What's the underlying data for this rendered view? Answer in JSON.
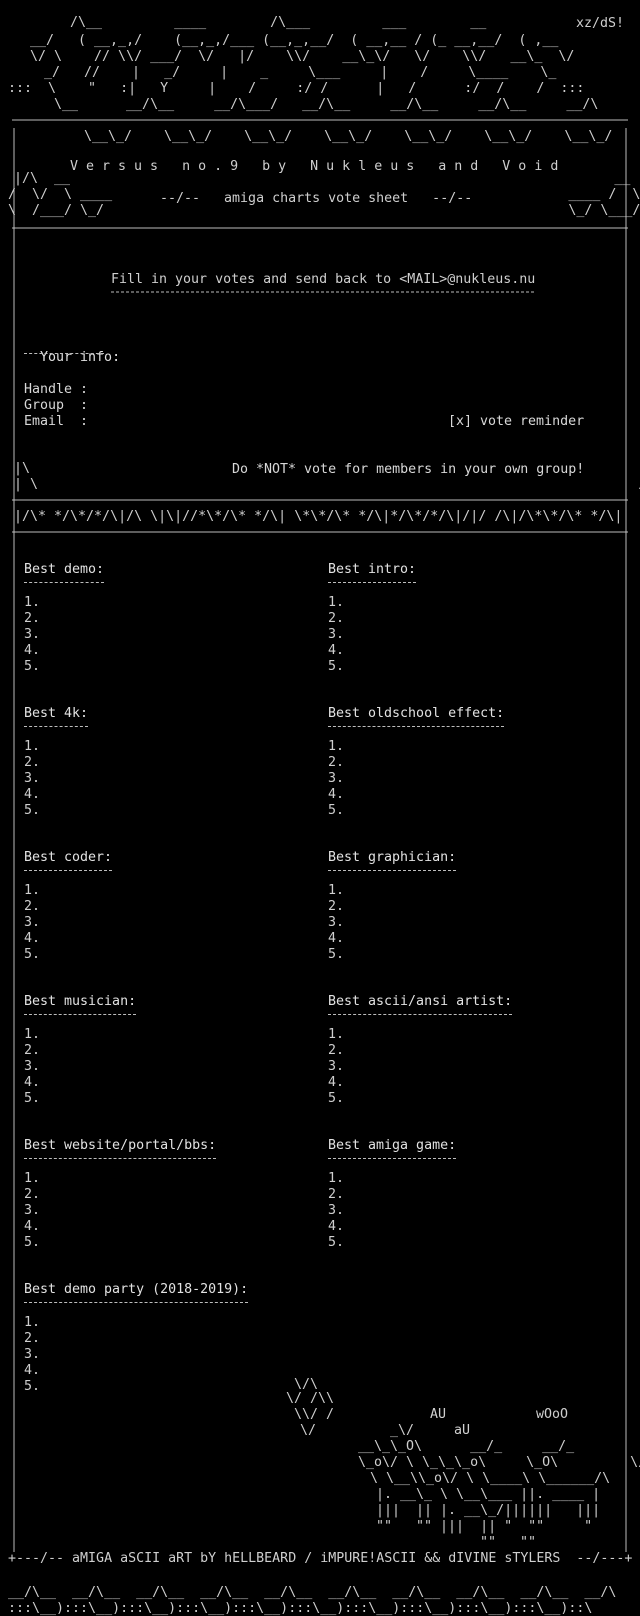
{
  "header": {
    "tag": "xz/dS!",
    "title": "V e r s u s   n o . 9   b y   N u k l e u s   a n d   V o i d",
    "subtitle": "--/--   amiga charts vote sheet   --/--"
  },
  "instruction": {
    "text": "Fill in your votes and send back to <MAIL>@nukleus.nu"
  },
  "info": {
    "heading": "Your info:",
    "handle_label": "Handle :",
    "group_label": "Group  :",
    "email_label": "Email  :",
    "reminder": "[x] vote reminder",
    "warning": "Do *NOT* vote for members in your own group!"
  },
  "divider": "|/\\* */\\*/*/\\|/\\ \\|\\|//*\\*/\\* */\\| \\*\\*/\\* */\\|*/\\*/*/\\|/|/ /\\|/\\*\\*/\\* */\\|",
  "categories": [
    {
      "title": "Best demo:",
      "slots": [
        "1.",
        "2.",
        "3.",
        "4.",
        "5."
      ]
    },
    {
      "title": "Best intro:",
      "slots": [
        "1.",
        "2.",
        "3.",
        "4.",
        "5."
      ]
    },
    {
      "title": "Best 4k:",
      "slots": [
        "1.",
        "2.",
        "3.",
        "4.",
        "5."
      ]
    },
    {
      "title": "Best oldschool effect:",
      "slots": [
        "1.",
        "2.",
        "3.",
        "4.",
        "5."
      ]
    },
    {
      "title": "Best coder:",
      "slots": [
        "1.",
        "2.",
        "3.",
        "4.",
        "5."
      ]
    },
    {
      "title": "Best graphician:",
      "slots": [
        "1.",
        "2.",
        "3.",
        "4.",
        "5."
      ]
    },
    {
      "title": "Best musician:",
      "slots": [
        "1.",
        "2.",
        "3.",
        "4.",
        "5."
      ]
    },
    {
      "title": "Best ascii/ansi artist:",
      "slots": [
        "1.",
        "2.",
        "3.",
        "4.",
        "5."
      ]
    },
    {
      "title": "Best website/portal/bbs:",
      "slots": [
        "1.",
        "2.",
        "3.",
        "4.",
        "5."
      ]
    },
    {
      "title": "Best amiga game:",
      "slots": [
        "1.",
        "2.",
        "3.",
        "4.",
        "5."
      ]
    },
    {
      "title": "Best demo party (2018-2019):",
      "slots": [
        "1.",
        "2.",
        "3.",
        "4.",
        "5."
      ]
    }
  ],
  "art_tags": {
    "au1": "AU",
    "au2": "aU",
    "wooo": "wOoO"
  },
  "footer": {
    "credit": "+---/-- aMIGA aSCII aRT bY hELLBEARD / iMPURE!ASCII && dIVINE sTYLERS  --/---+"
  }
}
